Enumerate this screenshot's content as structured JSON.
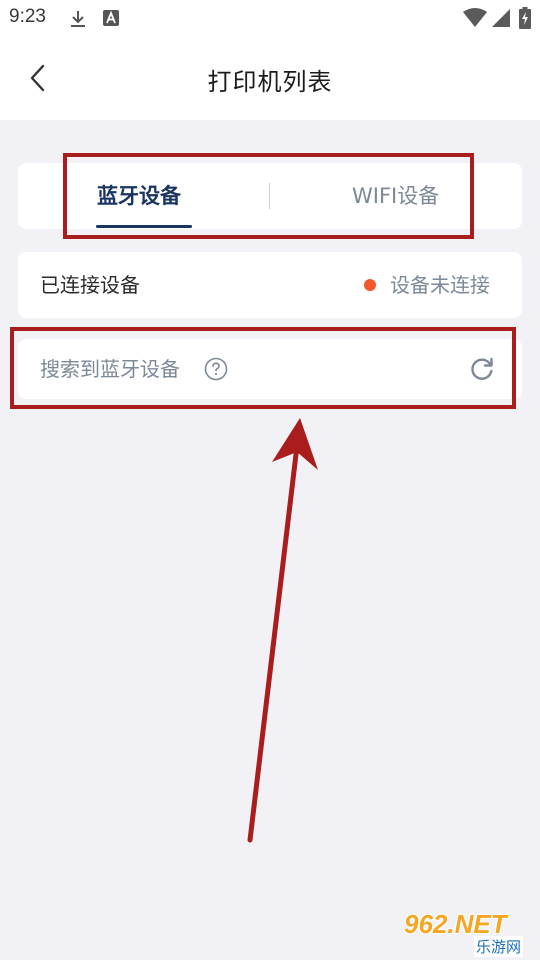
{
  "status_bar": {
    "time": "9:23",
    "icons": [
      "download-icon",
      "notification-a-icon",
      "wifi-icon",
      "signal-icon",
      "battery-charging-icon"
    ]
  },
  "header": {
    "title": "打印机列表",
    "back_icon": "chevron-left-icon"
  },
  "tabs": [
    {
      "label": "蓝牙设备",
      "active": true
    },
    {
      "label": "WIFI设备",
      "active": false
    }
  ],
  "connected": {
    "label": "已连接设备",
    "status": "设备未连接",
    "status_color": "#f2592a"
  },
  "search": {
    "label": "搜索到蓝牙设备",
    "help_icon": "question-circle-icon",
    "refresh_icon": "refresh-icon"
  },
  "annotation": {
    "highlight_color": "#a91d1d"
  },
  "watermark": {
    "main": "962.NET",
    "sub": "乐游网"
  }
}
